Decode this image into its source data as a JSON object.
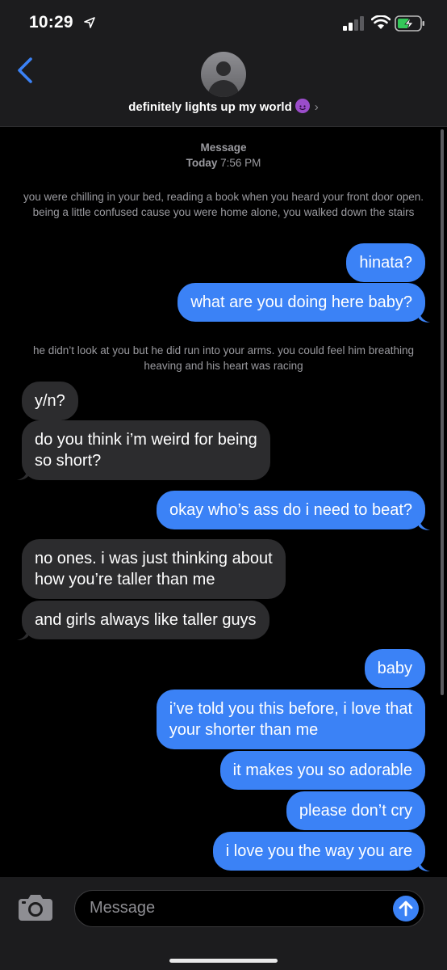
{
  "status_bar": {
    "time": "10:29"
  },
  "header": {
    "contact_name": "definitely lights up my world",
    "emoji_icon": "smiling-devil-emoji",
    "chevron": "›"
  },
  "thread": {
    "service_label": "Message",
    "date_label": "Today",
    "time_label": "7:56 PM",
    "narration_1": "you were chilling in your bed, reading a book when you heard your front door open. being a little confused cause you were home alone, you walked down the stairs",
    "narration_2": "he didn’t look at you but he did run into your arms. you could feel him breathing heaving and his heart was racing",
    "messages": [
      {
        "side": "out",
        "text": "hinata?"
      },
      {
        "side": "out",
        "text": "what are you doing here baby?"
      },
      {
        "side": "in",
        "text": "y/n?"
      },
      {
        "side": "in",
        "line1": "do you think i’m weird for being",
        "line2": "so short?"
      },
      {
        "side": "out",
        "text": "okay who’s ass do i need to beat?"
      },
      {
        "side": "in",
        "line1": "no ones. i was just thinking about",
        "line2": "how you’re taller than me"
      },
      {
        "side": "in",
        "text": "and girls always like taller guys"
      },
      {
        "side": "out",
        "text": "baby"
      },
      {
        "side": "out",
        "line1": "i’ve told you this before, i love that",
        "line2": "your shorter than me"
      },
      {
        "side": "out",
        "text": "it makes you so adorable"
      },
      {
        "side": "out",
        "text": "please don’t cry"
      },
      {
        "side": "out",
        "text": "i love you the way you are"
      }
    ]
  },
  "input": {
    "placeholder": "Message"
  },
  "colors": {
    "outgoing": "#3b82f6",
    "incoming": "#2c2c2e",
    "background": "#000000",
    "bars": "#1c1c1e"
  }
}
